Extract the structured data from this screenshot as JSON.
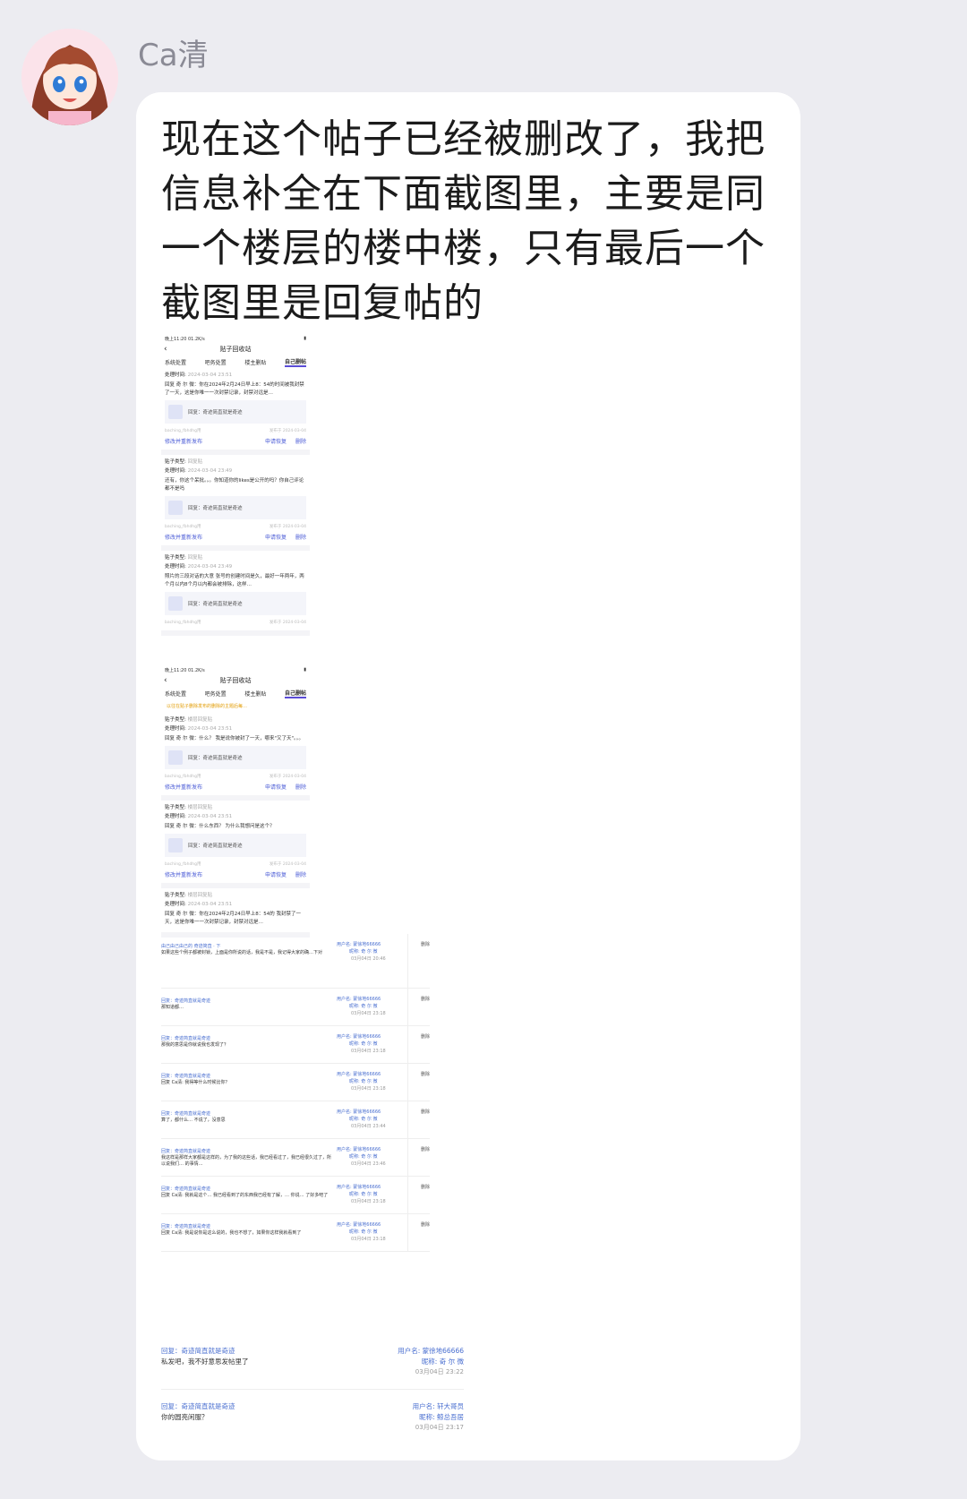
{
  "sender": {
    "name": "Ca清"
  },
  "message": {
    "text": "现在这个帖子已经被删改了，我把信息补全在下面截图里，主要是同一个楼层的楼中楼，只有最后一个截图里是回复帖的"
  },
  "shot1": {
    "status": "晚上11:20 01.2K/s",
    "title": "贴子回收站",
    "tabs": [
      "系统处置",
      "吧务处置",
      "楼主删贴",
      "自己删帖"
    ],
    "posts": [
      {
        "type": "",
        "time": "2024-03-04 23:51",
        "body": "回复 奇 尔 微：你在2024年2月24日早上8：54的时间被我封禁了一天，这是你唯一一次封禁记录，封禁对远是…",
        "ref": "回复：奇迹简直就是奇迹",
        "user": "baching_fbhdhg用",
        "date": "发布于 2024-03-04",
        "acts": [
          "修改并重新发布",
          "申请恢复",
          "删除"
        ]
      },
      {
        "type": "回复贴",
        "time": "2024-03-04 23:49",
        "body": "还有，你这个呆批。。。你知道你的likes是公开的吗？你自己评论都不是吗",
        "ref": "回复：奇迹简直就是奇迹",
        "user": "baching_fbhdhg用",
        "date": "发布于 2024-03-04",
        "acts": [
          "修改并重新发布",
          "申请恢复",
          "删除"
        ]
      },
      {
        "type": "回复贴",
        "time": "2024-03-04 23:49",
        "body": "照片的三段对话的大意  张号的创建时间是久，最好一年两年，两个月以内8个月以内都会被排除，这样…",
        "ref": "回复：奇迹简直就是奇迹",
        "user": "baching_fbhdhg用",
        "date": "发布于 2024-03-04"
      }
    ]
  },
  "shot2": {
    "status": "晚上11:20 01.2K/s",
    "title": "贴子回收站",
    "tabs": [
      "系统处置",
      "吧务处置",
      "楼主删贴",
      "自己删帖"
    ],
    "banner": "以往在贴子删除发布的删除的主题后每…",
    "posts": [
      {
        "type": "楼层回复贴",
        "time": "2024-03-04 23:51",
        "body": "回复 奇 尔 微：什么？ 我是说你被封了一天，哪来\"又了天\"。。。",
        "ref": "回复：奇迹简直就是奇迹",
        "user": "baching_fbhdhg用",
        "date": "发布于 2024-03-04",
        "acts": [
          "修改并重新发布",
          "申请恢复",
          "删除"
        ]
      },
      {
        "type": "楼层回复贴",
        "time": "2024-03-04 23:51",
        "body": "回复 奇 尔 微：什么东西？ 为什么我想问是这个？",
        "ref": "回复：奇迹简直就是奇迹",
        "user": "baching_fbhdhg用",
        "date": "发布于 2024-03-04",
        "acts": [
          "修改并重新发布",
          "申请恢复",
          "删除"
        ]
      },
      {
        "type": "楼层回复贴",
        "time": "2024-03-04 23:51",
        "body": "回复 奇 尔 微：你在2024年2月24日早上8：54的 我封禁了一天，这是你唯一一次封禁记录，封禁对远是…"
      }
    ]
  },
  "thread": {
    "rows": [
      {
        "rl": "由己由己由己的  奇迹简直 · 下",
        "ct": "如果这些个例子都被封锁，上面是你所说的话，我是不是，我记得大家的确…下对",
        "un": "用户名: 蒙徐地66666",
        "nk": "昵称: 奇 尔 微",
        "tm": "03月04日 20:46",
        "dl": "删除"
      },
      {
        "rl": "回复：奇迹简直就是奇迹",
        "ct": "那知道都…",
        "un": "用户名: 蒙徐地66666",
        "nk": "昵称: 奇 尔 微",
        "tm": "03月04日 23:18",
        "dl": "删除"
      },
      {
        "rl": "回复：奇迹简直就是奇迹",
        "ct": "那我的意思是你就说我也发现了？",
        "un": "用户名: 蒙徐地66666",
        "nk": "昵称: 奇 尔 微",
        "tm": "03月04日 23:18",
        "dl": "删除"
      },
      {
        "rl": "回复：奇迹简直就是奇迹",
        "ct": "回复 Ca清: 我得等什么时候比你？",
        "un": "用户名: 蒙徐地66666",
        "nk": "昵称: 奇 尔 微",
        "tm": "03月04日 23:18",
        "dl": "删除"
      },
      {
        "rl": "回复：奇迹简直就是奇迹",
        "ct": "算了，都什么… 不说了，没意思",
        "un": "用户名: 蒙徐地66666",
        "nk": "昵称: 奇 尔 微",
        "tm": "03月04日 23:44",
        "dl": "删除"
      },
      {
        "rl": "回复：奇迹简直就是奇迹",
        "ct": "我这样是那样大家都是这样的，为了我的这些话，我已经看过了，我已经很久过了，所以说我们… 的事情…",
        "un": "用户名: 蒙徐地66666",
        "nk": "昵称: 奇 尔 微",
        "tm": "03月04日 23:46",
        "dl": "删除"
      },
      {
        "rl": "回复：奇迹简直就是奇迹",
        "ct": "回复 Ca清: 我就是这个… 我已经看到了的东西我已经有了解，… 你说… 了好多吧了",
        "un": "用户名: 蒙徐地66666",
        "nk": "昵称: 奇 尔 微",
        "tm": "03月04日 23:18",
        "dl": "删除"
      },
      {
        "rl": "回复：奇迹简直就是奇迹",
        "ct": "回复 Ca清: 我是说你是这么说的，我也不想了，如果你这样我就看到了",
        "un": "用户名: 蒙徐地66666",
        "nk": "昵称: 奇 尔 微",
        "tm": "03月04日 23:18",
        "dl": "删除"
      }
    ]
  },
  "big": [
    {
      "rl": "回复：奇迹简直就是奇迹",
      "ct": "私发吧，我不好意思发帖里了",
      "un": "用户名: 蒙徐地66666",
      "nk": "昵称: 奇 尔 微",
      "tm": "03月04日 23:22"
    },
    {
      "rl": "回复：奇迹简直就是奇迹",
      "ct": "你的圆亮闲服？",
      "un": "用户名: 轩大哥员",
      "nk": "昵称: 鲸总吾居",
      "tm": "03月04日 23:17"
    }
  ]
}
